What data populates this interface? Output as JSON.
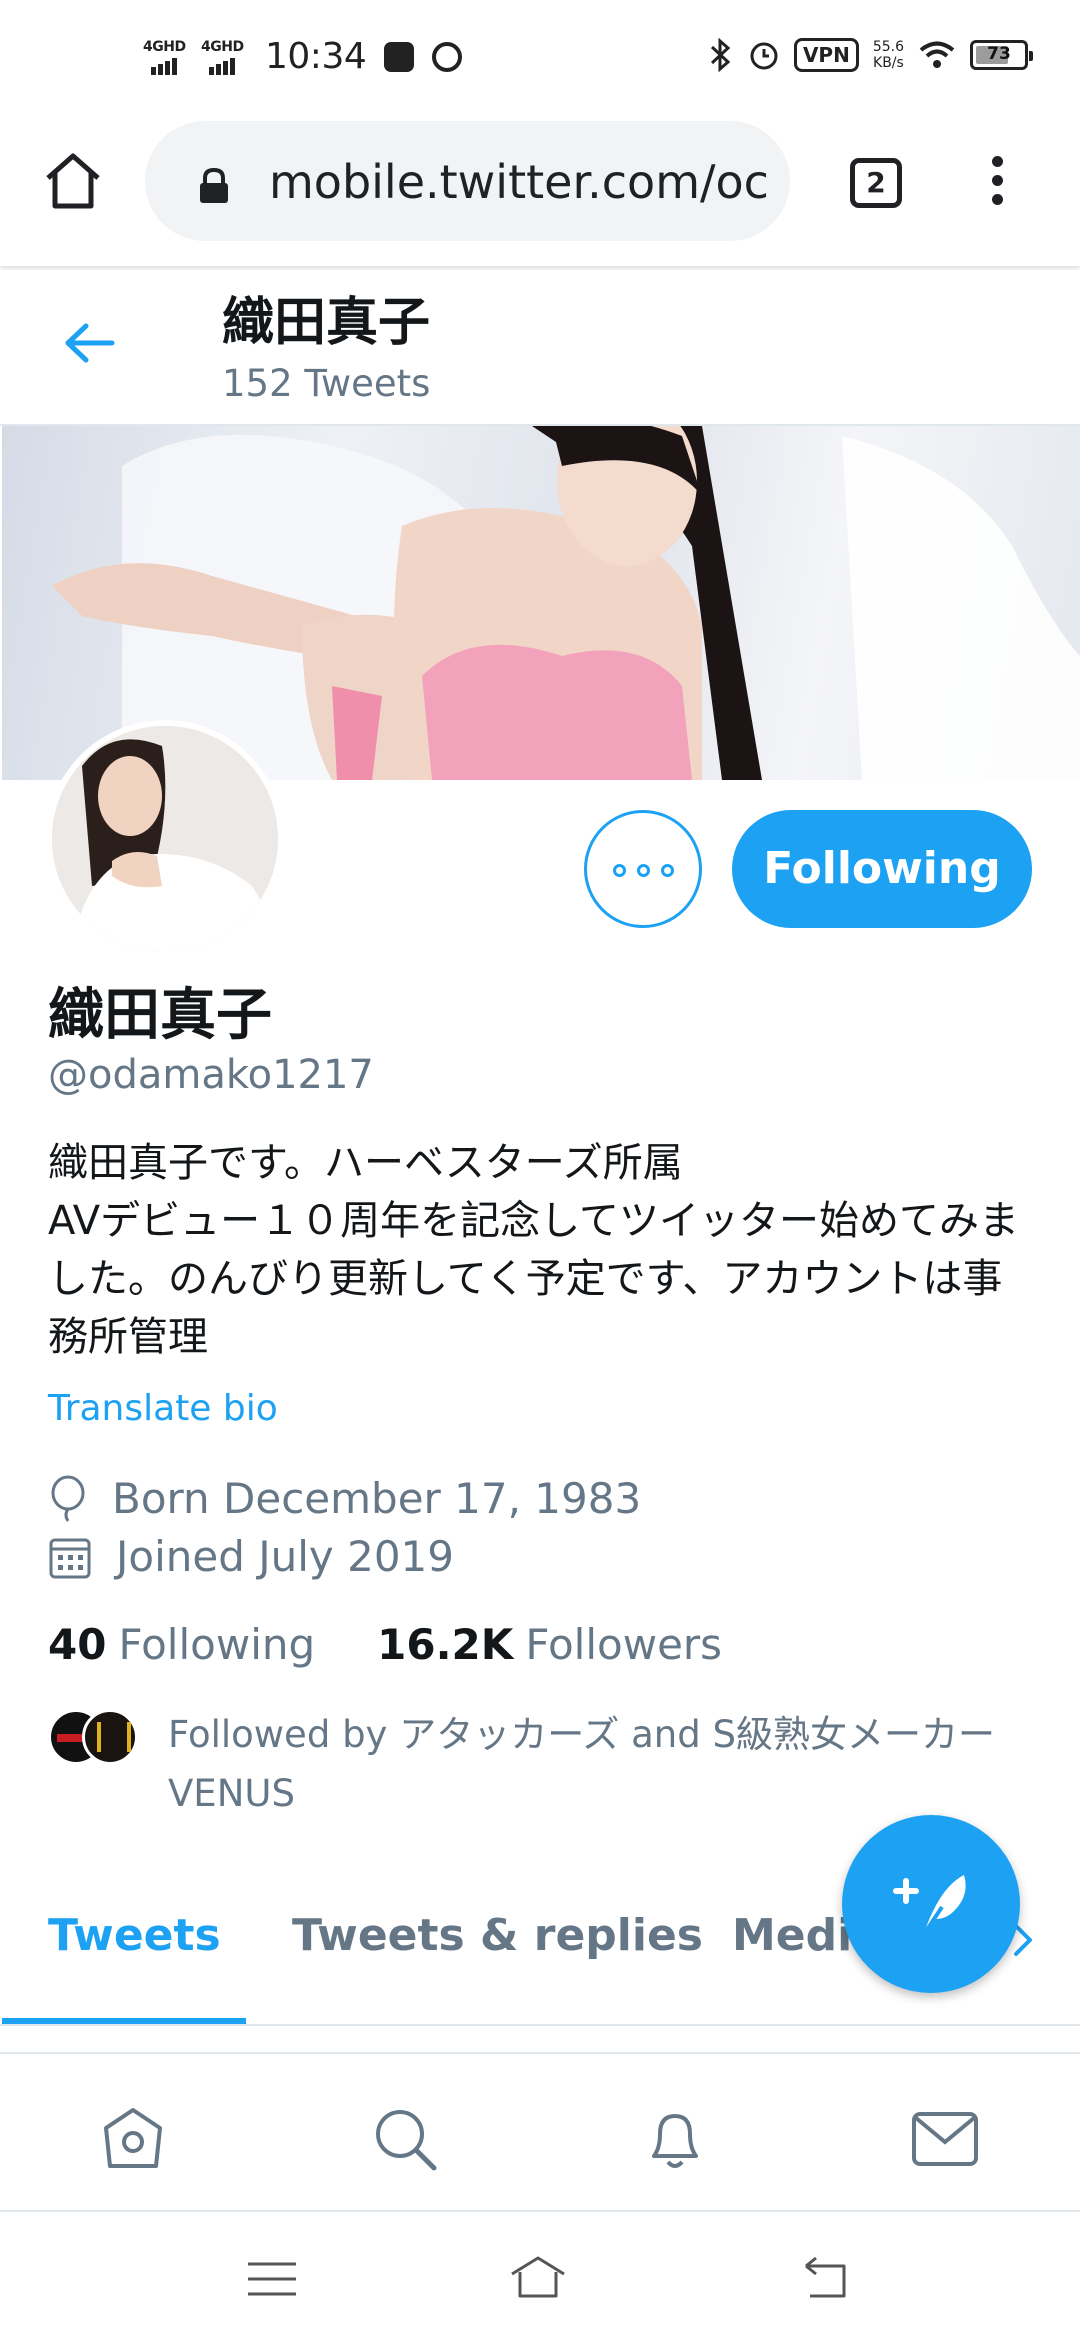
{
  "status_bar": {
    "network_1": "4GHD",
    "network_2": "4GHD",
    "time": "10:34",
    "vpn": "VPN",
    "speed_value": "55.6",
    "speed_unit": "KB/s",
    "battery": "73"
  },
  "browser": {
    "url": "mobile.twitter.com/oc",
    "tab_count": "2"
  },
  "profile_header": {
    "name": "織田真子",
    "tweet_count": "152 Tweets"
  },
  "profile": {
    "following_button": "Following",
    "name": "織田真子",
    "handle": "@odamako1217",
    "bio": "織田真子です。ハーベスターズ所属\nAVデビュー１０周年を記念してツイッター始めてみました。のんびり更新してく予定です、アカウントは事務所管理",
    "translate_link": "Translate bio",
    "born": "Born December 17, 1983",
    "joined": "Joined July 2019",
    "following_count": "40",
    "following_label": "Following",
    "followers_count": "16.2K",
    "followers_label": "Followers",
    "followed_by": "Followed by アタッカーズ and S級熟女メーカーVENUS"
  },
  "tabs": [
    {
      "label": "Tweets",
      "active": true
    },
    {
      "label": "Tweets & replies",
      "active": false
    },
    {
      "label": "Media",
      "active": false
    }
  ],
  "icons": {
    "browser": [
      "home-icon",
      "lock-icon",
      "tabs-icon",
      "more-vert-icon"
    ],
    "bottom_nav": [
      "home-icon",
      "search-icon",
      "notifications-bell-icon",
      "messages-envelope-icon"
    ],
    "system_nav": [
      "menu-lines-icon",
      "home-outline-icon",
      "back-arrow-icon"
    ]
  },
  "colors": {
    "accent": "#1da1f2",
    "secondary_text": "#657786",
    "primary_text": "#14171a"
  }
}
